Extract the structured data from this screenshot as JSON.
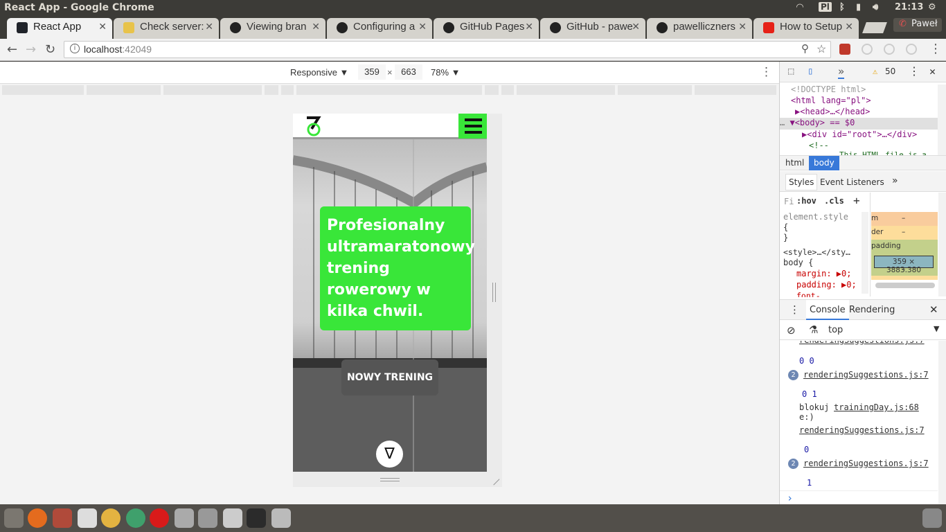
{
  "window": {
    "title": "React App - Google Chrome",
    "time": "21:13",
    "user": "Paweł",
    "lang": "Pl"
  },
  "tabs": [
    {
      "label": "React App",
      "color": "#20232a"
    },
    {
      "label": "Check server:",
      "color": "#e8c34a"
    },
    {
      "label": "Viewing bran",
      "color": "#222222"
    },
    {
      "label": "Configuring a",
      "color": "#222222"
    },
    {
      "label": "GitHub Pages",
      "color": "#222222"
    },
    {
      "label": "GitHub - pawe",
      "color": "#222222"
    },
    {
      "label": "pawelliczners",
      "color": "#222222"
    },
    {
      "label": "How to Setup",
      "color": "#e62117"
    }
  ],
  "omnibox": {
    "host": "localhost",
    "port": ":42049"
  },
  "device_toolbar": {
    "device": "Responsive",
    "width": "359",
    "times": "×",
    "height": "663",
    "zoom": "78%"
  },
  "app": {
    "headline": "Profesionalny ultramaratonowy trening rowerowy w kilka chwil.",
    "cta": "NOWY TRENING",
    "scroll_glyph": "∇",
    "accent": "#39e639"
  },
  "devtools": {
    "warnings": "50",
    "dom": [
      "<!DOCTYPE html>",
      "<html lang=\"pl\">",
      "<head>…</head>",
      "<body> == $0",
      "<div id=\"root\">…</div>",
      "<!--",
      "This HTML file is a"
    ],
    "crumbs": [
      "html",
      "body"
    ],
    "panes": [
      "Styles",
      "Event Listeners"
    ],
    "filter": "Fi",
    "hov": ":hov",
    "cls": ".cls",
    "styles": [
      "element.style",
      "{",
      "}",
      "<style>…</sty…",
      "body {",
      "margin: ▶0;",
      "padding: ▶0;",
      "font-"
    ],
    "box": {
      "m": "m",
      "border": "der",
      "padding": "padding",
      "dims": "359 × 3883.380",
      "dash": "–"
    },
    "console_tabs": [
      "Console",
      "Rendering"
    ],
    "context": "top",
    "log": [
      {
        "src": "renderingSuggestions.js:7",
        "msg": "0 0",
        "count": ""
      },
      {
        "src": "renderingSuggestions.js:7",
        "msg": "0 1",
        "count": "2"
      },
      {
        "src": "trainingDay.js:68",
        "msg": "blokuj e:)",
        "count": ""
      },
      {
        "src": "renderingSuggestions.js:7",
        "msg": "0",
        "count": ""
      },
      {
        "src": "renderingSuggestions.js:7",
        "msg": "1",
        "count": "2"
      }
    ],
    "prompt": "›"
  }
}
